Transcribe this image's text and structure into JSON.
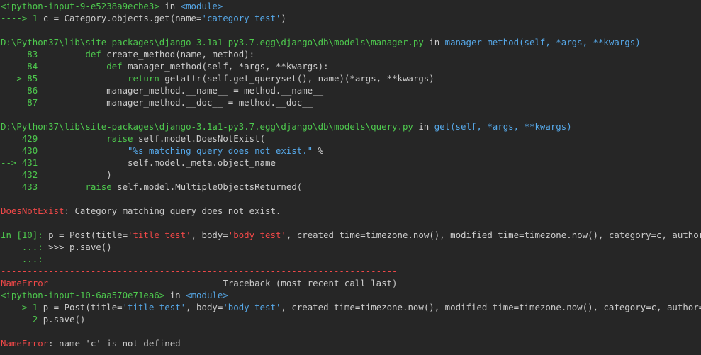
{
  "colors": {
    "background": "#262626",
    "default": "#cccccc",
    "green": "#4ec94e",
    "yellow": "#c8c83c",
    "blue": "#56a8e8",
    "red": "#f04848"
  },
  "lines": [
    [
      {
        "t": "<ipython-input-9-e5238a9ecbe3>",
        "c": "green"
      },
      {
        "t": " in ",
        "c": "gray"
      },
      {
        "t": "<module>",
        "c": "blue"
      }
    ],
    [
      {
        "t": "----> 1 ",
        "c": "green"
      },
      {
        "t": "c = Category.objects.get(name=",
        "c": "gray"
      },
      {
        "t": "'category test'",
        "c": "blue"
      },
      {
        "t": ")",
        "c": "gray"
      }
    ],
    [
      {
        "t": "",
        "c": "gray"
      }
    ],
    [
      {
        "t": "D:\\Python37\\lib\\site-packages\\django-3.1a1-py3.7.egg\\django\\db\\models\\manager.py",
        "c": "green"
      },
      {
        "t": " in ",
        "c": "gray"
      },
      {
        "t": "manager_method(self, *args, **kwargs)",
        "c": "blue"
      }
    ],
    [
      {
        "t": "     83 ",
        "c": "green"
      },
      {
        "t": "        ",
        "c": "gray"
      },
      {
        "t": "def",
        "c": "green"
      },
      {
        "t": " create_method(name, method):",
        "c": "gray"
      }
    ],
    [
      {
        "t": "     84 ",
        "c": "green"
      },
      {
        "t": "            ",
        "c": "gray"
      },
      {
        "t": "def",
        "c": "green"
      },
      {
        "t": " manager_method(self, *args, **kwargs):",
        "c": "gray"
      }
    ],
    [
      {
        "t": "---> 85 ",
        "c": "green"
      },
      {
        "t": "                ",
        "c": "gray"
      },
      {
        "t": "return",
        "c": "green"
      },
      {
        "t": " getattr(self.get_queryset(), name)(*args, **kwargs)",
        "c": "gray"
      }
    ],
    [
      {
        "t": "     86 ",
        "c": "green"
      },
      {
        "t": "            manager_method.__name__ = method.__name__",
        "c": "gray"
      }
    ],
    [
      {
        "t": "     87 ",
        "c": "green"
      },
      {
        "t": "            manager_method.__doc__ = method.__doc__",
        "c": "gray"
      }
    ],
    [
      {
        "t": "",
        "c": "gray"
      }
    ],
    [
      {
        "t": "D:\\Python37\\lib\\site-packages\\django-3.1a1-py3.7.egg\\django\\db\\models\\query.py",
        "c": "green"
      },
      {
        "t": " in ",
        "c": "gray"
      },
      {
        "t": "get(self, *args, **kwargs)",
        "c": "blue"
      }
    ],
    [
      {
        "t": "    429 ",
        "c": "green"
      },
      {
        "t": "            ",
        "c": "gray"
      },
      {
        "t": "raise",
        "c": "green"
      },
      {
        "t": " self.model.DoesNotExist(",
        "c": "gray"
      }
    ],
    [
      {
        "t": "    430 ",
        "c": "green"
      },
      {
        "t": "                ",
        "c": "gray"
      },
      {
        "t": "\"%s matching query does not exist.\"",
        "c": "blue"
      },
      {
        "t": " %",
        "c": "gray"
      }
    ],
    [
      {
        "t": "--> 431 ",
        "c": "green"
      },
      {
        "t": "                self.model._meta.object_name",
        "c": "gray"
      }
    ],
    [
      {
        "t": "    432 ",
        "c": "green"
      },
      {
        "t": "            )",
        "c": "gray"
      }
    ],
    [
      {
        "t": "    433 ",
        "c": "green"
      },
      {
        "t": "        ",
        "c": "gray"
      },
      {
        "t": "raise",
        "c": "green"
      },
      {
        "t": " self.model.MultipleObjectsReturned(",
        "c": "gray"
      }
    ],
    [
      {
        "t": "",
        "c": "gray"
      }
    ],
    [
      {
        "t": "DoesNotExist",
        "c": "red"
      },
      {
        "t": ": Category matching query does not exist.",
        "c": "gray"
      }
    ],
    [
      {
        "t": "",
        "c": "gray"
      }
    ],
    [
      {
        "t": "In [10]: ",
        "c": "green"
      },
      {
        "t": "p = Post(title=",
        "c": "gray"
      },
      {
        "t": "'title test'",
        "c": "red"
      },
      {
        "t": ", body=",
        "c": "gray"
      },
      {
        "t": "'body test'",
        "c": "red"
      },
      {
        "t": ", created_time=timezone.now(), modified_time=timezone.now(), category=c, author=user)",
        "c": "gray"
      }
    ],
    [
      {
        "t": "    ...: ",
        "c": "green"
      },
      {
        "t": ">>> p.save()",
        "c": "gray"
      }
    ],
    [
      {
        "t": "    ...:",
        "c": "green"
      }
    ],
    [
      {
        "t": "---------------------------------------------------------------------------",
        "c": "red"
      }
    ],
    [
      {
        "t": "NameError",
        "c": "red"
      },
      {
        "t": "                                 Traceback (most recent call last)",
        "c": "gray"
      }
    ],
    [
      {
        "t": "<ipython-input-10-6aa570e71ea6>",
        "c": "green"
      },
      {
        "t": " in ",
        "c": "gray"
      },
      {
        "t": "<module>",
        "c": "blue"
      }
    ],
    [
      {
        "t": "----> 1 ",
        "c": "green"
      },
      {
        "t": "p = Post(title=",
        "c": "gray"
      },
      {
        "t": "'title test'",
        "c": "blue"
      },
      {
        "t": ", body=",
        "c": "gray"
      },
      {
        "t": "'body test'",
        "c": "blue"
      },
      {
        "t": ", created_time=timezone.now(), modified_time=timezone.now(), category=c, author=user)",
        "c": "gray"
      }
    ],
    [
      {
        "t": "      2 ",
        "c": "green"
      },
      {
        "t": "p.save()",
        "c": "gray"
      }
    ],
    [
      {
        "t": "",
        "c": "gray"
      }
    ],
    [
      {
        "t": "NameError",
        "c": "red"
      },
      {
        "t": ": name 'c' is not defined",
        "c": "gray"
      }
    ]
  ]
}
